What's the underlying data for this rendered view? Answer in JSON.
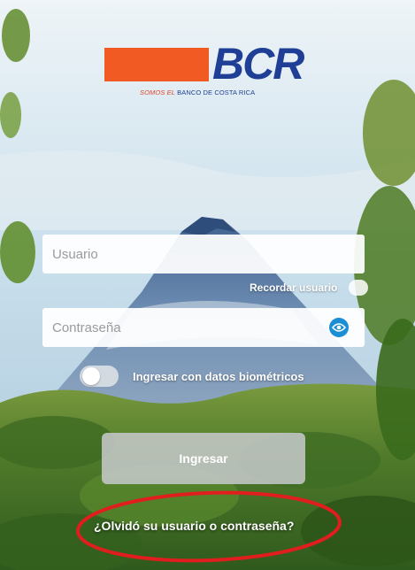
{
  "brand": {
    "logo_text": "BCR",
    "tagline_prefix": "SOMOS EL",
    "tagline_rest": "BANCO DE COSTA RICA"
  },
  "login": {
    "username_placeholder": "Usuario",
    "password_placeholder": "Contraseña",
    "remember_label": "Recordar usuario",
    "biometric_label": "Ingresar con datos biométricos",
    "submit_label": "Ingresar",
    "forgot_link": "¿Olvidó su usuario o contraseña?"
  },
  "icons": {
    "password_toggle": "eye-icon"
  },
  "colors": {
    "brand_orange": "#f15a22",
    "brand_blue": "#1f3f96",
    "eye_blue": "#1b8fd6",
    "annotation_red": "#e01e1e"
  }
}
